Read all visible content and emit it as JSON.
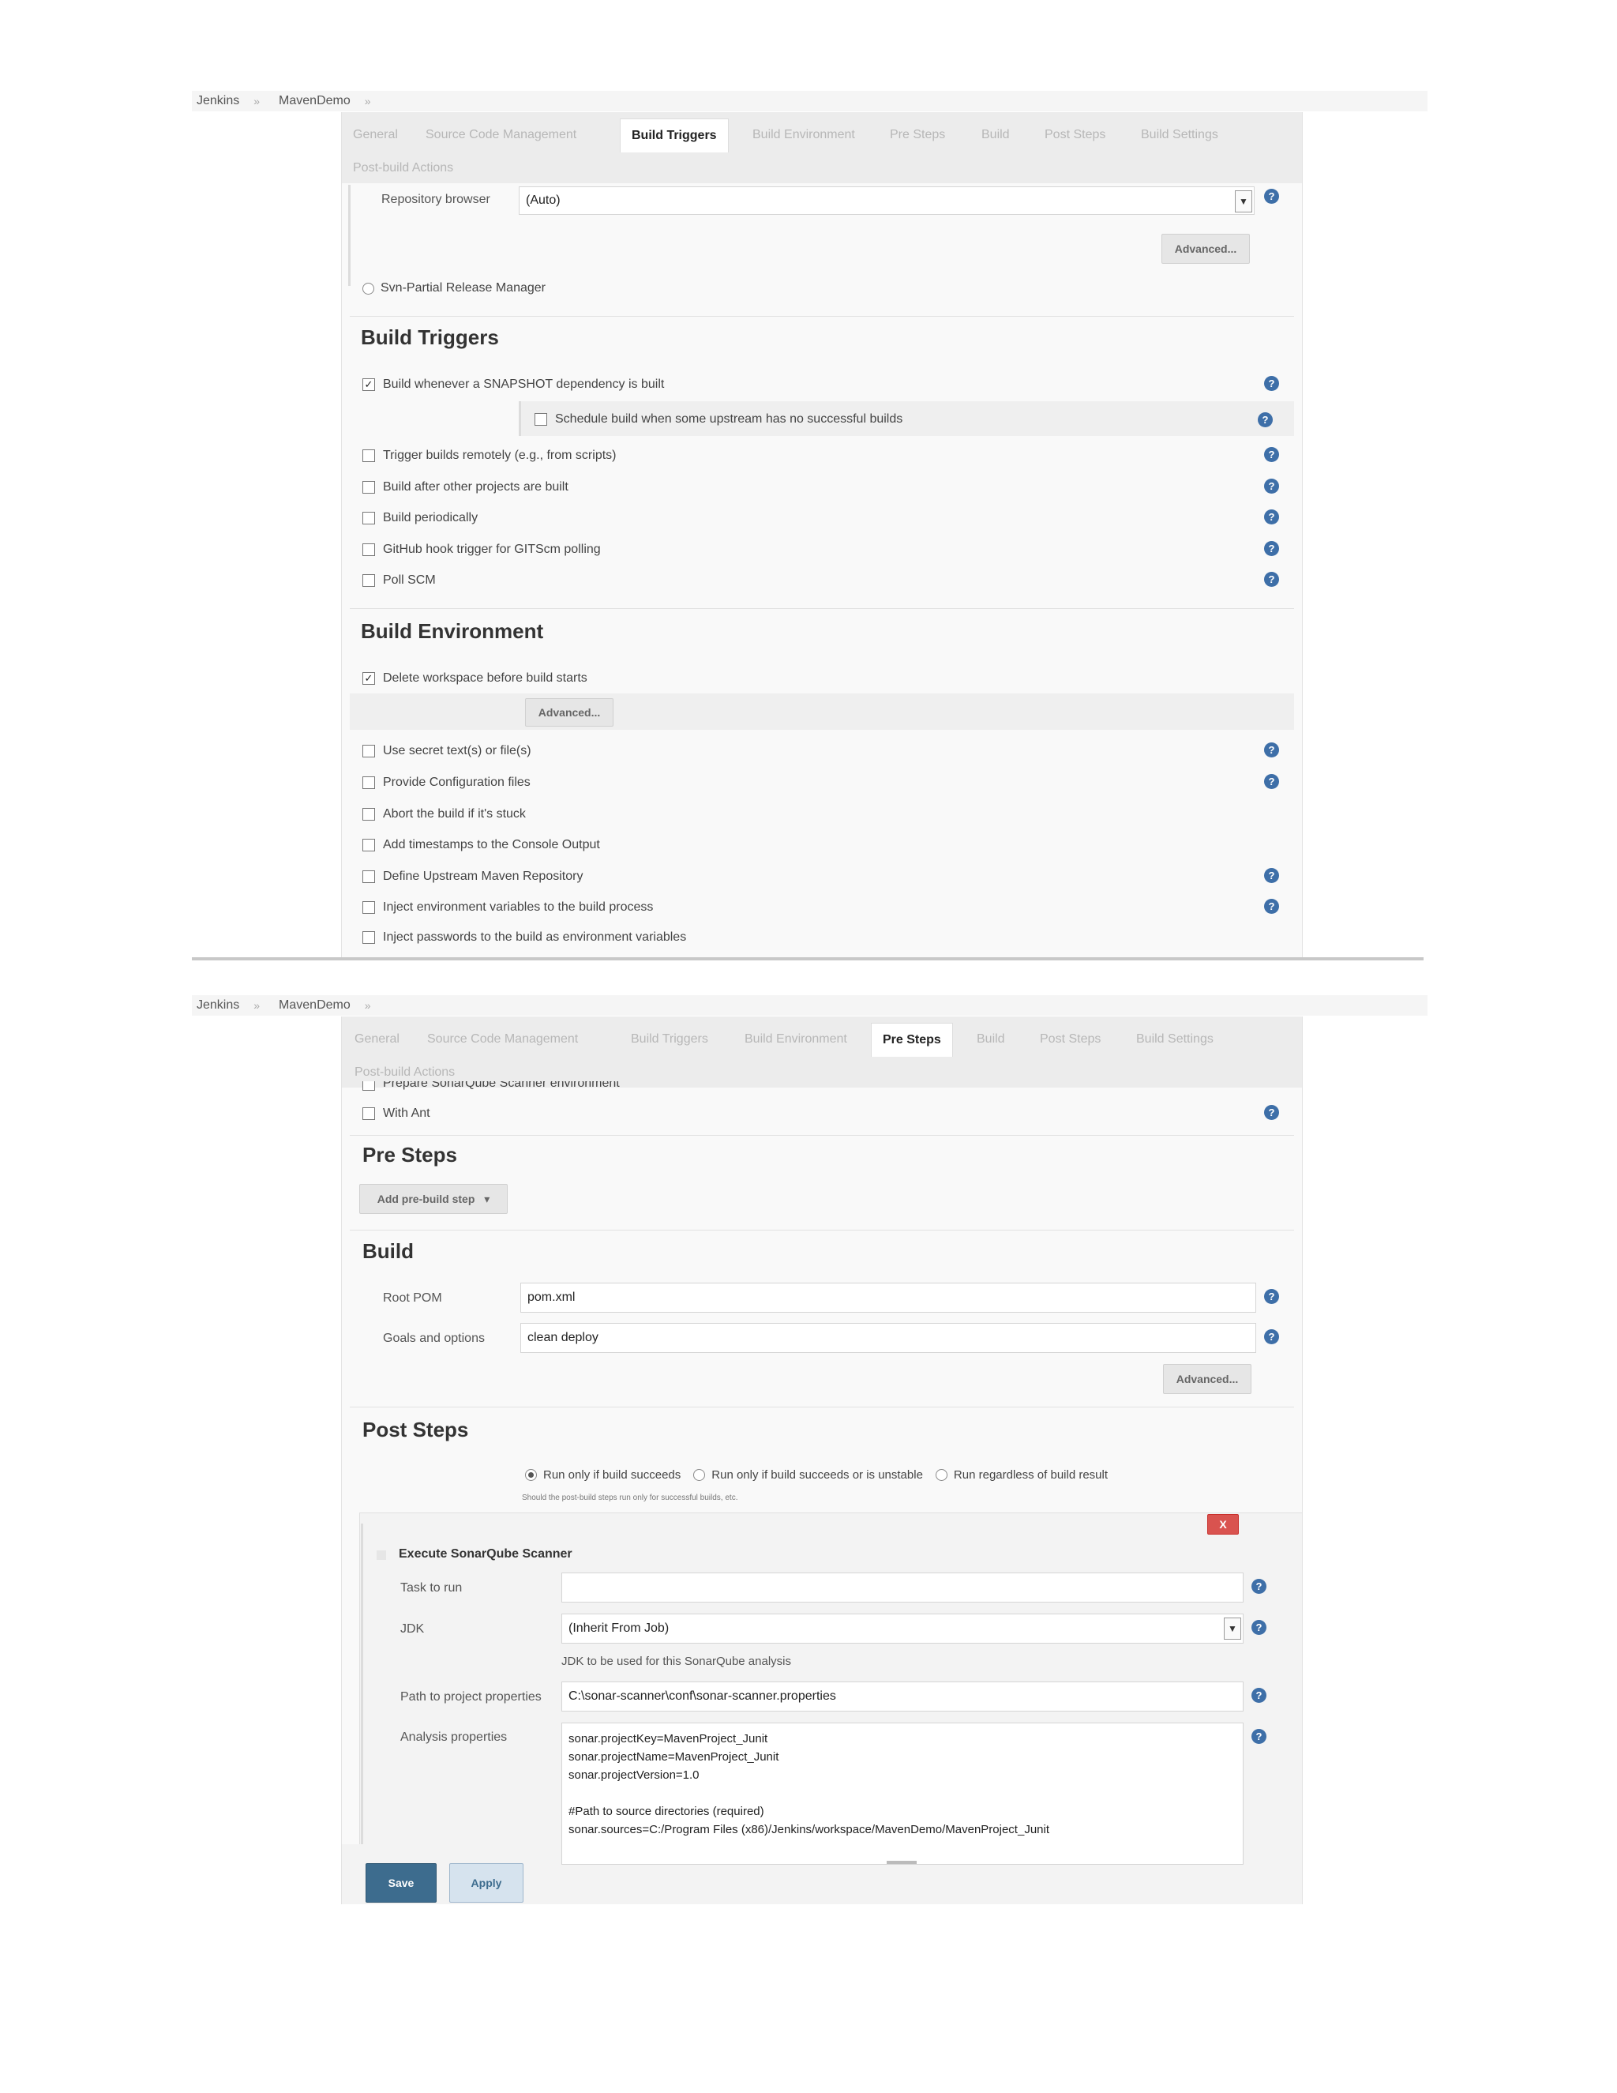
{
  "breadcrumb": {
    "root": "Jenkins",
    "project": "MavenDemo",
    "separator": "»"
  },
  "tabs_top": [
    {
      "label": "General",
      "active": false
    },
    {
      "label": "Source Code Management",
      "active": false
    },
    {
      "label": "Build Triggers",
      "active": true
    },
    {
      "label": "Build Environment",
      "active": false
    },
    {
      "label": "Pre Steps",
      "active": false
    },
    {
      "label": "Build",
      "active": false
    },
    {
      "label": "Post Steps",
      "active": false
    },
    {
      "label": "Build Settings",
      "active": false
    },
    {
      "label": "Post-build Actions",
      "active": false
    }
  ],
  "tabs_bottom": [
    {
      "label": "General",
      "active": false
    },
    {
      "label": "Source Code Management",
      "active": false
    },
    {
      "label": "Build Triggers",
      "active": false
    },
    {
      "label": "Build Environment",
      "active": false
    },
    {
      "label": "Pre Steps",
      "active": true
    },
    {
      "label": "Build",
      "active": false
    },
    {
      "label": "Post Steps",
      "active": false
    },
    {
      "label": "Build Settings",
      "active": false
    },
    {
      "label": "Post-build Actions",
      "active": false
    }
  ],
  "scm": {
    "repository_browser_label": "Repository browser",
    "repository_browser_value": "(Auto)",
    "advanced_label": "Advanced...",
    "svn_partial_label": "Svn-Partial Release Manager"
  },
  "build_triggers": {
    "title": "Build Triggers",
    "items": [
      {
        "label": "Build whenever a SNAPSHOT dependency is built",
        "checked": true
      },
      {
        "label": "Schedule build when some upstream has no successful builds",
        "checked": false
      },
      {
        "label": "Trigger builds remotely (e.g., from scripts)",
        "checked": false
      },
      {
        "label": "Build after other projects are built",
        "checked": false
      },
      {
        "label": "Build periodically",
        "checked": false
      },
      {
        "label": "GitHub hook trigger for GITScm polling",
        "checked": false
      },
      {
        "label": "Poll SCM",
        "checked": false
      }
    ]
  },
  "build_environment": {
    "title": "Build Environment",
    "advanced_label": "Advanced...",
    "items": [
      {
        "label": "Delete workspace before build starts",
        "checked": true
      },
      {
        "label": "Use secret text(s) or file(s)",
        "checked": false
      },
      {
        "label": "Provide Configuration files",
        "checked": false
      },
      {
        "label": "Abort the build if it's stuck",
        "checked": false
      },
      {
        "label": "Add timestamps to the Console Output",
        "checked": false
      },
      {
        "label": "Define Upstream Maven Repository",
        "checked": false
      },
      {
        "label": "Inject environment variables to the build process",
        "checked": false
      },
      {
        "label": "Inject passwords to the build as environment variables",
        "checked": false
      }
    ]
  },
  "env_bottom": {
    "partial_item": "Prepare SonarQube Scanner environment",
    "with_ant": "With Ant"
  },
  "pre_steps": {
    "title": "Pre Steps",
    "add_button": "Add pre-build step"
  },
  "build": {
    "title": "Build",
    "root_pom_label": "Root POM",
    "root_pom_value": "pom.xml",
    "goals_label": "Goals and options",
    "goals_value": "clean deploy",
    "advanced_label": "Advanced..."
  },
  "post_steps": {
    "title": "Post Steps",
    "options": [
      {
        "label": "Run only if build succeeds",
        "selected": true
      },
      {
        "label": "Run only if build succeeds or is unstable",
        "selected": false
      },
      {
        "label": "Run regardless of build result",
        "selected": false
      }
    ],
    "hint": "Should the post-build steps run only for successful builds, etc.",
    "sonar": {
      "title": "Execute SonarQube Scanner",
      "delete_label": "X",
      "task_label": "Task to run",
      "task_value": "",
      "jdk_label": "JDK",
      "jdk_value": "(Inherit From Job)",
      "jdk_hint": "JDK to be used for this SonarQube analysis",
      "path_label": "Path to project properties",
      "path_value": "C:\\sonar-scanner\\conf\\sonar-scanner.properties",
      "analysis_label": "Analysis properties",
      "analysis_lines": [
        "sonar.projectKey=MavenProject_Junit",
        "sonar.projectName=MavenProject_Junit",
        "sonar.projectVersion=1.0",
        "",
        "#Path to source directories (required)",
        "sonar.sources=C:/Program Files (x86)/Jenkins/workspace/MavenDemo/MavenProject_Junit"
      ]
    }
  },
  "actions": {
    "save_label": "Save",
    "apply_label": "Apply"
  },
  "icons": {
    "help": "help-icon",
    "checkmark": "check-icon"
  },
  "colors": {
    "help_icon": "#3e6fa8",
    "save_button": "#3d6c8e",
    "apply_button": "#d6e3ee",
    "delete_button": "#d9534f"
  }
}
